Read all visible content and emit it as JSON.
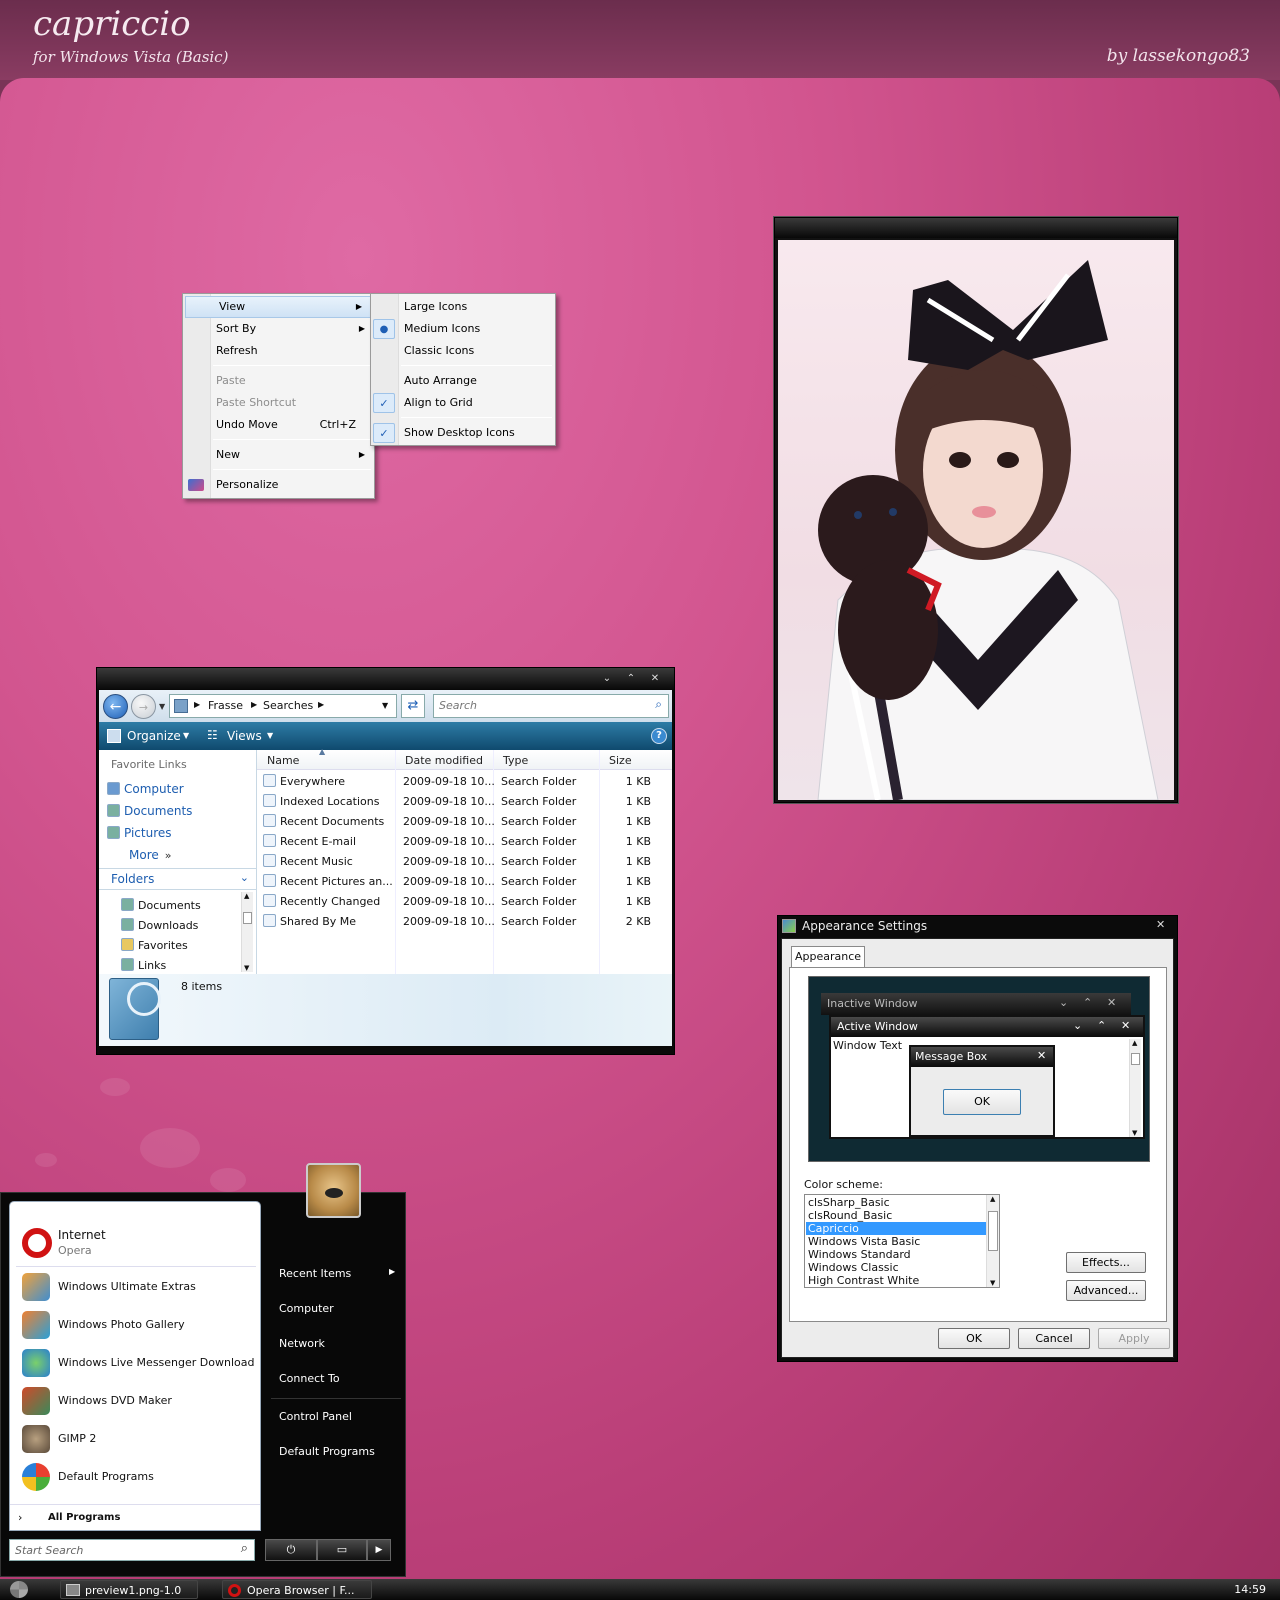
{
  "header": {
    "title": "capriccio",
    "subtitle": "for Windows Vista (Basic)",
    "author": "by lassekongo83"
  },
  "context_menu": {
    "items": [
      {
        "label": "View",
        "selected": true,
        "submenu": true
      },
      {
        "label": "Sort By",
        "submenu": true
      },
      {
        "label": "Refresh"
      },
      {
        "label": "Paste",
        "disabled": true
      },
      {
        "label": "Paste Shortcut",
        "disabled": true
      },
      {
        "label": "Undo Move",
        "shortcut": "Ctrl+Z"
      },
      {
        "label": "New",
        "submenu": true
      },
      {
        "label": "Personalize"
      }
    ],
    "view_submenu": [
      "Large Icons",
      "Medium Icons",
      "Classic Icons",
      "Auto Arrange",
      "Align to Grid",
      "Show Desktop Icons"
    ]
  },
  "explorer": {
    "breadcrumb": [
      "Frasse",
      "Searches"
    ],
    "search_placeholder": "Search",
    "organize": "Organize",
    "views": "Views",
    "favorite_links_title": "Favorite Links",
    "favorite_links": [
      "Computer",
      "Documents",
      "Pictures"
    ],
    "more": "More",
    "folders_title": "Folders",
    "folders": [
      "Documents",
      "Downloads",
      "Favorites",
      "Links"
    ],
    "columns": [
      "Name",
      "Date modified",
      "Type",
      "Size"
    ],
    "rows": [
      [
        "Everywhere",
        "2009-09-18 10...",
        "Search Folder",
        "1 KB"
      ],
      [
        "Indexed Locations",
        "2009-09-18 10...",
        "Search Folder",
        "1 KB"
      ],
      [
        "Recent Documents",
        "2009-09-18 10...",
        "Search Folder",
        "1 KB"
      ],
      [
        "Recent E-mail",
        "2009-09-18 10...",
        "Search Folder",
        "1 KB"
      ],
      [
        "Recent Music",
        "2009-09-18 10...",
        "Search Folder",
        "1 KB"
      ],
      [
        "Recent Pictures an...",
        "2009-09-18 10...",
        "Search Folder",
        "1 KB"
      ],
      [
        "Recently Changed",
        "2009-09-18 10...",
        "Search Folder",
        "1 KB"
      ],
      [
        "Shared By Me",
        "2009-09-18 10...",
        "Search Folder",
        "2 KB"
      ]
    ],
    "status": "8 items"
  },
  "start_menu": {
    "pinned": {
      "name": "Internet",
      "sub": "Opera"
    },
    "programs": [
      "Windows Ultimate Extras",
      "Windows Photo Gallery",
      "Windows Live Messenger Download",
      "Windows DVD Maker",
      "GIMP 2",
      "Default Programs"
    ],
    "all_programs": "All Programs",
    "search_placeholder": "Start Search",
    "right_items": [
      "Recent Items",
      "Computer",
      "Network",
      "Connect To",
      "Control Panel",
      "Default Programs"
    ]
  },
  "appearance": {
    "title": "Appearance Settings",
    "tab": "Appearance",
    "inactive_window": "Inactive Window",
    "active_window": "Active Window",
    "window_text": "Window Text",
    "message_box": "Message Box",
    "ok_inner": "OK",
    "color_scheme_label": "Color scheme:",
    "schemes": [
      "clsSharp_Basic",
      "clsRound_Basic",
      "Capriccio",
      "Windows Vista Basic",
      "Windows Standard",
      "Windows Classic",
      "High Contrast White"
    ],
    "selected_scheme": "Capriccio",
    "effects": "Effects...",
    "advanced": "Advanced...",
    "ok": "OK",
    "cancel": "Cancel",
    "apply": "Apply"
  },
  "taskbar": {
    "buttons": [
      "preview1.png-1.0 (...",
      "Opera Browser | F..."
    ],
    "clock": "14:59"
  }
}
